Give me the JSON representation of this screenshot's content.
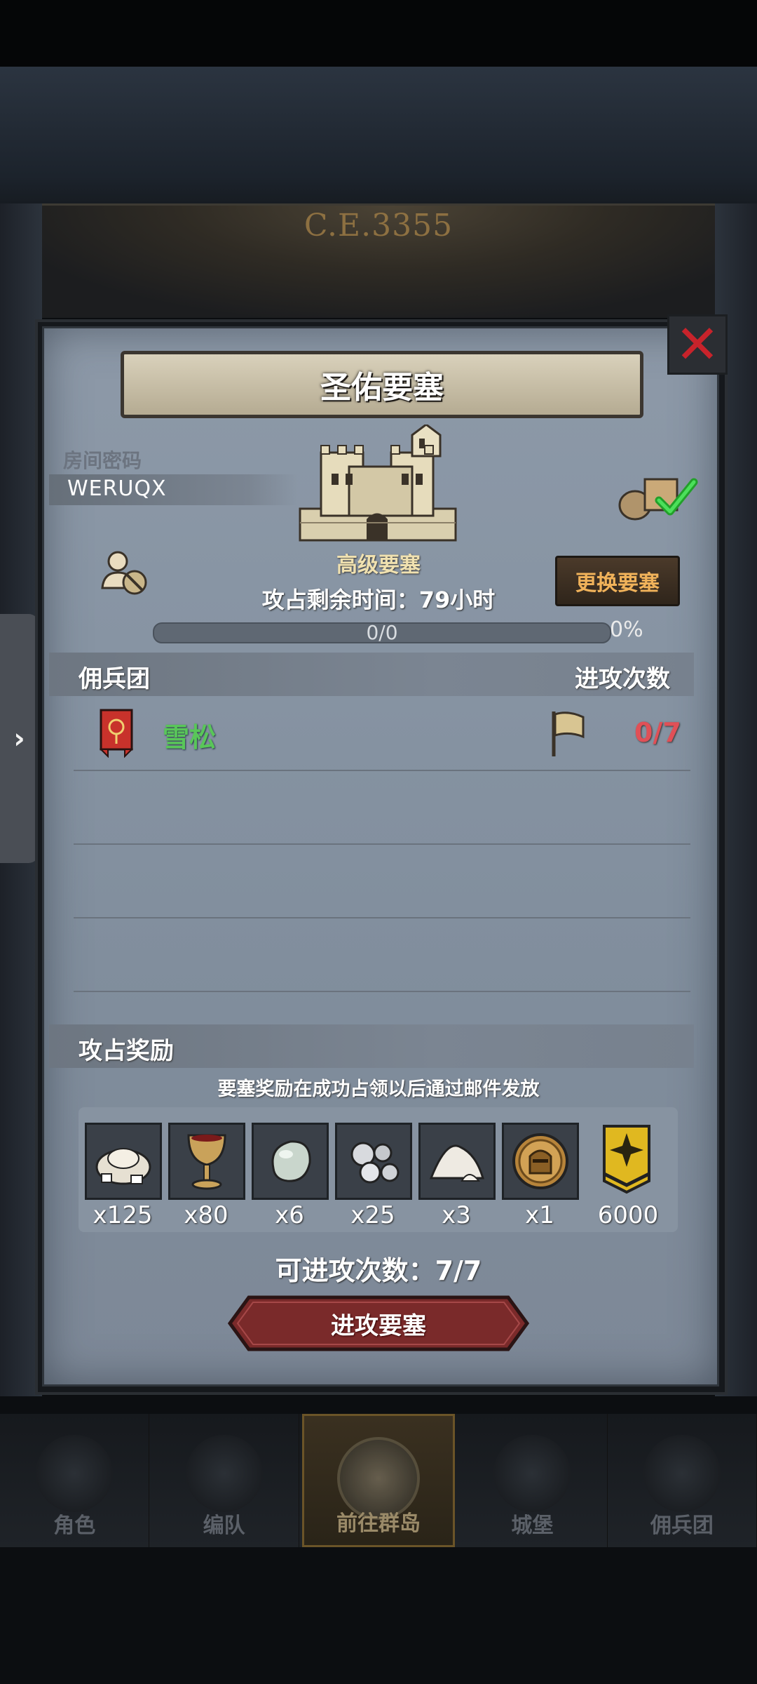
{
  "background": {
    "era_label": "C.E.3355"
  },
  "dialog": {
    "title": "圣佑要塞",
    "room_password_label": "房间密码",
    "room_password_value": "WERUQX",
    "fortress_grade": "高级要塞",
    "time_remaining": "攻占剩余时间：79小时",
    "change_fortress_button": "更换要塞",
    "progress": {
      "text": "0/0",
      "percent_label": "0%",
      "fraction": 0
    },
    "mercenary_section": {
      "title": "佣兵团",
      "attack_count_header": "进攻次数",
      "rows": [
        {
          "name": "雪松",
          "attacks": "0/7"
        }
      ]
    },
    "rewards_section": {
      "title": "攻占奖励",
      "note": "要塞奖励在成功占领以后通过邮件发放",
      "items": [
        {
          "icon": "stone-pile-icon",
          "qty": "x125"
        },
        {
          "icon": "goblet-icon",
          "qty": "x80"
        },
        {
          "icon": "pale-gem-icon",
          "qty": "x6"
        },
        {
          "icon": "silver-ore-icon",
          "qty": "x25"
        },
        {
          "icon": "salt-pile-icon",
          "qty": "x3"
        },
        {
          "icon": "knight-coin-icon",
          "qty": "x1"
        },
        {
          "icon": "guild-emblem-icon",
          "qty": "6000"
        }
      ]
    },
    "attempts_label": "可进攻次数：7/7",
    "attack_button": "进攻要塞"
  },
  "bottom_nav": {
    "items": [
      {
        "label": "角色",
        "icon": "knight-icon"
      },
      {
        "label": "编队",
        "icon": "formation-icon"
      },
      {
        "label": "前往群岛",
        "icon": "compass-map-icon"
      },
      {
        "label": "城堡",
        "icon": "castle-icon"
      },
      {
        "label": "佣兵团",
        "icon": "mercenary-tower-icon"
      }
    ],
    "active_index": 2
  },
  "side_tab": {
    "glyph": "›"
  },
  "colors": {
    "accent_gold": "#f0b25a",
    "merc_green": "#59c659",
    "count_red": "#e05057",
    "close_red": "#c8232b"
  }
}
